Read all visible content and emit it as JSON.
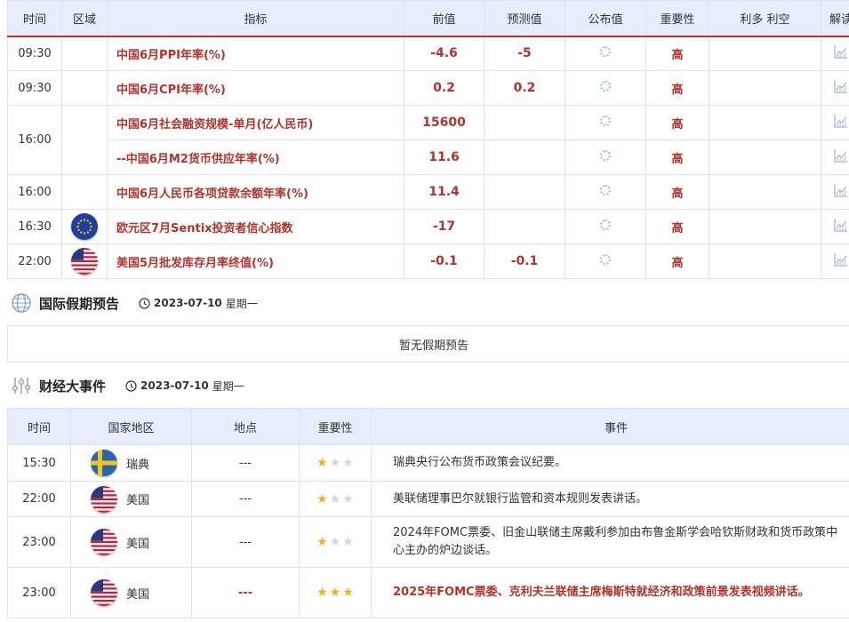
{
  "eco_table": {
    "headers": [
      "时间",
      "区域",
      "指标",
      "前值",
      "预测值",
      "公布值",
      "重要性",
      "利多 利空",
      "解读"
    ],
    "rows": [
      {
        "time": "09:30",
        "region": "",
        "indicator": "中国6月PPI年率(%)",
        "prev": "-4.6",
        "forecast": "-5",
        "importance": "高"
      },
      {
        "time": "09:30",
        "region": "",
        "indicator": "中国6月CPI年率(%)",
        "prev": "0.2",
        "forecast": "0.2",
        "importance": "高"
      },
      {
        "time": "16:00",
        "region": "",
        "indicator": "中国6月社会融资规模-单月(亿人民币)",
        "prev": "15600",
        "forecast": "",
        "importance": "高"
      },
      {
        "time": "",
        "region": "",
        "indicator": "--中国6月M2货币供应年率(%)",
        "prev": "11.6",
        "forecast": "",
        "importance": "高"
      },
      {
        "time": "16:00",
        "region": "",
        "indicator": "中国6月人民币各项贷款余额年率(%)",
        "prev": "11.4",
        "forecast": "",
        "importance": "高"
      },
      {
        "time": "16:30",
        "region": "eu-flag",
        "indicator": "欧元区7月Sentix投资者信心指数",
        "prev": "-17",
        "forecast": "",
        "importance": "高"
      },
      {
        "time": "22:00",
        "region": "us-flag",
        "indicator": "美国5月批发库存月率终值(%)",
        "prev": "-0.1",
        "forecast": "-0.1",
        "importance": "高"
      }
    ]
  },
  "holiday_section": {
    "title": "国际假期预告",
    "date": "2023-07-10",
    "weekday": "星期一",
    "empty_text": "暂无假期预告"
  },
  "events_section": {
    "title": "财经大事件",
    "date": "2023-07-10",
    "weekday": "星期一",
    "headers": [
      "时间",
      "国家地区",
      "地点",
      "重要性",
      "事件"
    ],
    "rows": [
      {
        "time": "15:30",
        "flag": "sweden-flag",
        "country": "瑞典",
        "location": "---",
        "stars": 1,
        "event": "瑞典央行公布货币政策会议纪要。",
        "high": false
      },
      {
        "time": "22:00",
        "flag": "us-flag",
        "country": "美国",
        "location": "---",
        "stars": 1,
        "event": "美联储理事巴尔就银行监管和资本规则发表讲话。",
        "high": false
      },
      {
        "time": "23:00",
        "flag": "us-flag",
        "country": "美国",
        "location": "---",
        "stars": 1,
        "event": "2024年FOMC票委、旧金山联储主席戴利参加由布鲁金斯学会哈钦斯财政和货币政策中心主办的炉边谈话。",
        "high": false
      },
      {
        "time": "23:00",
        "flag": "us-flag",
        "country": "美国",
        "location": "---",
        "stars": 3,
        "event": "2025年FOMC票委、克利夫兰联储主席梅斯特就经济和政策前景发表视频讲话。",
        "high": true
      }
    ]
  },
  "colors": {
    "accent": "#b3322b",
    "header_bg": "#e6eefb",
    "star_on": "#f2b01e",
    "star_off": "#d6d6d6"
  }
}
